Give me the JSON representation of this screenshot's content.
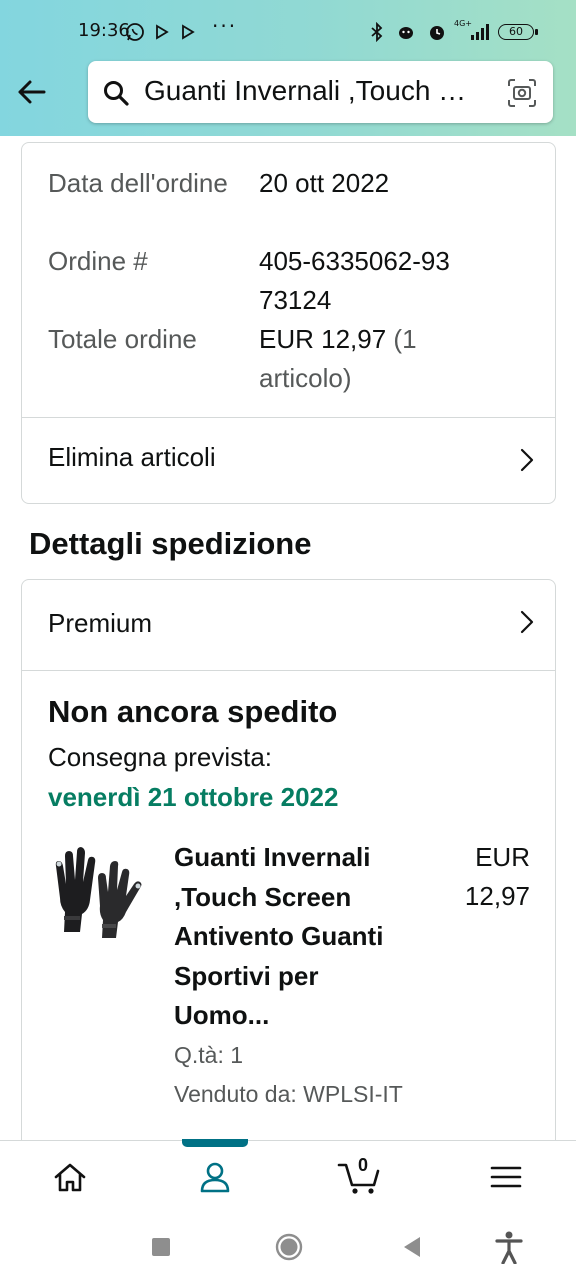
{
  "status_bar": {
    "time": "19:36",
    "network": "4G+",
    "battery": "60"
  },
  "search": {
    "query": "Guanti Invernali ,Touch Screen Antivento Guanti Sportivi per Uomo..."
  },
  "order": {
    "rows": [
      {
        "label": "Data dell'ordine",
        "value": "20 ott 2022"
      },
      {
        "label": "Ordine #",
        "value": "405-6335062-9373124"
      },
      {
        "label": "Totale ordine",
        "value": "EUR 12,97",
        "value_extra": "(1 articolo)"
      }
    ],
    "remove_items_link": "Elimina articoli"
  },
  "shipment": {
    "section_title": "Dettagli spedizione",
    "shipping_speed": "Premium",
    "status": "Non ancora spedito",
    "delivery_label": "Consegna prevista:",
    "delivery_date": "venerdì 21 ottobre 2022",
    "delivery_date_color": "#067d62",
    "item": {
      "title": "Guanti Invernali ,Touch Screen Antivento Guanti Sportivi per Uomo...",
      "price": "EUR 12,97",
      "quantity": "Q.tà: 1",
      "seller": "Venduto da: WPLSI-IT"
    }
  },
  "bottom_nav": {
    "items": [
      "home-icon",
      "account-icon",
      "cart-icon",
      "menu-icon"
    ],
    "cart_count": "0",
    "active": "account-icon",
    "accent_color": "#007185"
  }
}
